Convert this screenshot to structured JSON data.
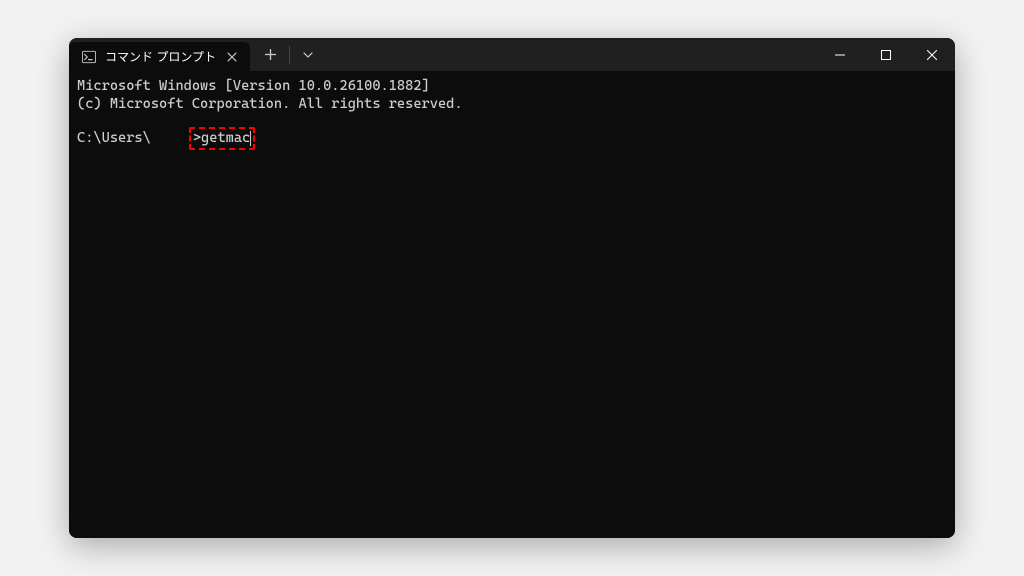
{
  "window": {
    "tab_title": "コマンド プロンプト"
  },
  "terminal": {
    "line1": "Microsoft Windows [Version 10.0.26100.1882]",
    "line2": "(c) Microsoft Corporation. All rights reserved.",
    "prompt_prefix": "C:\\Users\\",
    "prompt_suffix": ">",
    "command": "getmac"
  }
}
